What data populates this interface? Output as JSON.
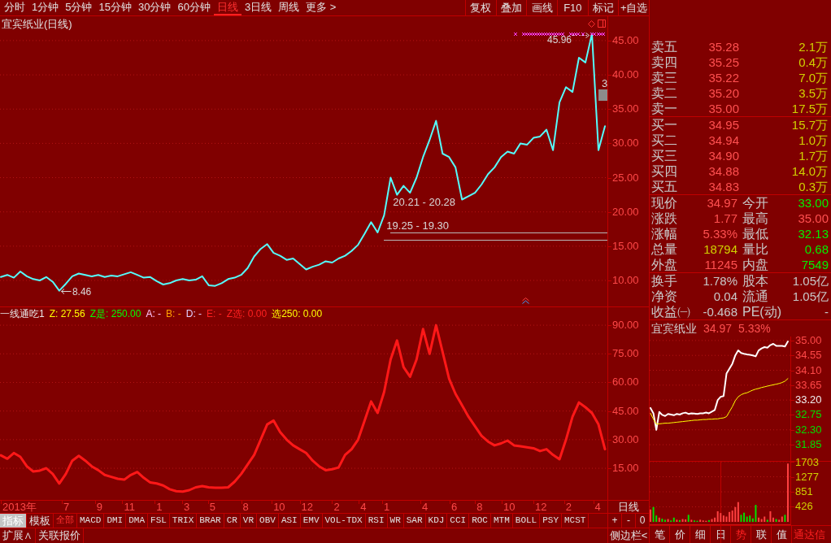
{
  "toolbar": {
    "periods": [
      {
        "label": "分时",
        "selected": false
      },
      {
        "label": "1分钟",
        "selected": false
      },
      {
        "label": "5分钟",
        "selected": false
      },
      {
        "label": "15分钟",
        "selected": false
      },
      {
        "label": "30分钟",
        "selected": false
      },
      {
        "label": "60分钟",
        "selected": false
      },
      {
        "label": "日线",
        "selected": true
      },
      {
        "label": "3日线",
        "selected": false
      },
      {
        "label": "周线",
        "selected": false
      },
      {
        "label": "更多 >",
        "selected": false
      }
    ],
    "buttons": [
      "复权",
      "叠加",
      "画线",
      "F10",
      "标记",
      "+自选"
    ]
  },
  "price_pane": {
    "title": "宜宾纸业(日线)",
    "chart_data": {
      "type": "line",
      "grid": true,
      "ylim": [
        6.2,
        48.55
      ],
      "yticks": [
        {
          "value": 10,
          "label": "10.00"
        },
        {
          "value": 15,
          "label": "15.00"
        },
        {
          "value": 20,
          "label": "20.00"
        },
        {
          "value": 25,
          "label": "25.00"
        },
        {
          "value": 30,
          "label": "30.00"
        },
        {
          "value": 35,
          "label": "35.00"
        },
        {
          "value": 40,
          "label": "40.00"
        },
        {
          "value": 45,
          "label": "45.00"
        }
      ],
      "values": [
        10.5,
        10.8,
        10.4,
        11.3,
        10.6,
        10.2,
        10.0,
        10.5,
        9.8,
        8.5,
        9.5,
        10.6,
        11.0,
        10.8,
        10.6,
        10.8,
        10.5,
        10.7,
        10.6,
        10.9,
        11.2,
        10.8,
        10.4,
        10.5,
        9.9,
        9.4,
        9.6,
        10.0,
        10.2,
        10.0,
        10.1,
        10.6,
        9.3,
        9.2,
        9.6,
        10.2,
        10.4,
        10.8,
        11.8,
        13.5,
        14.6,
        15.3,
        14.0,
        13.6,
        13.0,
        13.2,
        12.4,
        11.6,
        12.0,
        12.3,
        12.8,
        12.6,
        13.2,
        13.6,
        14.3,
        15.2,
        16.8,
        18.5,
        17.0,
        19.5,
        25.0,
        22.5,
        23.8,
        22.8,
        25.0,
        28.0,
        30.5,
        33.3,
        28.5,
        28.0,
        26.5,
        21.8,
        22.3,
        22.8,
        24.0,
        25.5,
        26.5,
        28.0,
        28.8,
        28.5,
        30.0,
        29.8,
        30.8,
        31.0,
        32.0,
        29.0,
        36.0,
        38.2,
        37.5,
        42.5,
        41.8,
        46.0,
        29.0,
        32.5
      ],
      "annotations": [
        "8.46",
        "45.96",
        "3",
        "20.21 - 20.28",
        "19.25 - 19.30"
      ]
    }
  },
  "indicator_pane": {
    "legend": [
      {
        "label": "一线通吃1",
        "color": "#e8e8e8"
      },
      {
        "label": "Z: 27.56",
        "color": "#ffff00"
      },
      {
        "label": "Z是: 250.00",
        "color": "#00ff00"
      },
      {
        "label": "A: -",
        "color": "#ffc8ff"
      },
      {
        "label": "B: -",
        "color": "#ffa000"
      },
      {
        "label": "D: -",
        "color": "#e0d0ff"
      },
      {
        "label": "E: -",
        "color": "#ff2020"
      },
      {
        "label": "Z选: 0.00",
        "color": "#ff2020"
      },
      {
        "label": "选250: 0.00",
        "color": "#ffff00"
      }
    ],
    "chart_data": {
      "type": "line",
      "grid": true,
      "ylim": [
        -1.6,
        99.4
      ],
      "yticks": [
        {
          "value": 15,
          "label": "15.00"
        },
        {
          "value": 30,
          "label": "30.00"
        },
        {
          "value": 45,
          "label": "45.00"
        },
        {
          "value": 60,
          "label": "60.00"
        },
        {
          "value": 75,
          "label": "75.00"
        },
        {
          "value": 90,
          "label": "90.00"
        }
      ],
      "values": [
        21.8,
        20,
        23,
        21,
        16,
        13.3,
        13.8,
        15,
        12,
        7,
        12,
        19,
        21.5,
        19,
        16,
        14,
        11.5,
        10.5,
        9.5,
        9,
        11.5,
        13,
        10,
        7.5,
        7,
        6,
        4,
        3,
        2.8,
        3.5,
        5,
        5.6,
        5,
        4.8,
        4.8,
        5,
        8,
        12,
        17,
        22,
        30,
        38,
        40,
        34,
        30,
        27,
        25,
        23,
        19,
        16,
        14,
        14.5,
        15.4,
        22,
        25,
        30,
        40,
        50,
        44,
        55,
        72,
        82,
        68,
        63,
        72,
        88,
        75,
        90,
        76,
        62,
        54,
        48,
        42,
        37,
        32,
        29,
        27,
        28,
        29.5,
        27,
        26.5,
        26,
        25.5,
        24,
        25,
        22,
        19.7,
        30,
        42,
        49.5,
        47,
        44,
        38,
        25
      ]
    }
  },
  "date_axis": {
    "ticks": [
      "2013年",
      "7",
      "9",
      "11",
      "1",
      "3",
      "5",
      "8",
      "10",
      "12",
      "2",
      "4",
      "1",
      "4",
      "6",
      "8",
      "10",
      "12",
      "2",
      "4"
    ],
    "period": "日线"
  },
  "indicator_bar": {
    "modes": [
      {
        "label": "指标",
        "selected": true
      },
      {
        "label": "模板",
        "selected": false
      }
    ],
    "indicators": [
      {
        "label": "全部",
        "selected": true
      },
      {
        "label": "MACD",
        "selected": false
      },
      {
        "label": "DMI",
        "selected": false
      },
      {
        "label": "DMA",
        "selected": false
      },
      {
        "label": "FSL",
        "selected": false
      },
      {
        "label": "TRIX",
        "selected": false
      },
      {
        "label": "BRAR",
        "selected": false
      },
      {
        "label": "CR",
        "selected": false
      },
      {
        "label": "VR",
        "selected": false
      },
      {
        "label": "OBV",
        "selected": false
      },
      {
        "label": "ASI",
        "selected": false
      },
      {
        "label": "EMV",
        "selected": false
      },
      {
        "label": "VOL-TDX",
        "selected": false
      },
      {
        "label": "RSI",
        "selected": false
      },
      {
        "label": "WR",
        "selected": false
      },
      {
        "label": "SAR",
        "selected": false
      },
      {
        "label": "KDJ",
        "selected": false
      },
      {
        "label": "CCI",
        "selected": false
      },
      {
        "label": "ROC",
        "selected": false
      },
      {
        "label": "MTM",
        "selected": false
      },
      {
        "label": "BOLL",
        "selected": false
      },
      {
        "label": "PSY",
        "selected": false
      },
      {
        "label": "MCST",
        "selected": false
      }
    ],
    "zoom_buttons": [
      "+",
      "-",
      "0"
    ]
  },
  "bottom_bar": {
    "buttons": [
      "扩展∧",
      "关联报价"
    ],
    "sidebar_toggle": "侧边栏<"
  },
  "quote_panel": {
    "asks": [
      {
        "label": "卖五",
        "price": "35.28",
        "volume": "2.1万"
      },
      {
        "label": "卖四",
        "price": "35.25",
        "volume": "0.4万"
      },
      {
        "label": "卖三",
        "price": "35.22",
        "volume": "7.0万"
      },
      {
        "label": "卖二",
        "price": "35.20",
        "volume": "3.5万"
      },
      {
        "label": "卖一",
        "price": "35.00",
        "volume": "17.5万"
      }
    ],
    "bids": [
      {
        "label": "买一",
        "price": "34.95",
        "volume": "15.7万"
      },
      {
        "label": "买二",
        "price": "34.94",
        "volume": "1.0万"
      },
      {
        "label": "买三",
        "price": "34.90",
        "volume": "1.7万"
      },
      {
        "label": "买四",
        "price": "34.88",
        "volume": "14.0万"
      },
      {
        "label": "买五",
        "price": "34.83",
        "volume": "0.3万"
      }
    ],
    "stats": [
      {
        "label": "现价",
        "value": "34.97",
        "color": "#ff5050"
      },
      {
        "label": "今开",
        "value": "33.00",
        "color": "#00f000"
      },
      {
        "label": "涨跌",
        "value": "1.77",
        "color": "#ff5050"
      },
      {
        "label": "最高",
        "value": "35.00",
        "color": "#ff5050"
      },
      {
        "label": "涨幅",
        "value": "5.33%",
        "color": "#ff5050"
      },
      {
        "label": "最低",
        "value": "32.13",
        "color": "#00f000"
      },
      {
        "label": "总量",
        "value": "18794",
        "color": "#d0d000"
      },
      {
        "label": "量比",
        "value": "0.68",
        "color": "#00f000"
      },
      {
        "label": "外盘",
        "value": "11245",
        "color": "#ff5050"
      },
      {
        "label": "内盘",
        "value": "7549",
        "color": "#00f000"
      }
    ],
    "info": [
      {
        "label": "换手",
        "value": "1.78%"
      },
      {
        "label": "股本",
        "value": "1.05亿"
      },
      {
        "label": "净资",
        "value": "0.04"
      },
      {
        "label": "流通",
        "value": "1.05亿"
      },
      {
        "label": "收益㈠",
        "value": "-0.468"
      },
      {
        "label": "PE(动)",
        "value": "-"
      }
    ]
  },
  "intraday": {
    "name": "宜宾纸业",
    "price": "34.97",
    "change": "5.33%",
    "chart_data": {
      "type": "line",
      "grid": true,
      "ylim": [
        31.36,
        35.12
      ],
      "yticks": [
        {
          "value": 35,
          "label": "35.00"
        },
        {
          "value": 34.55,
          "label": "34.55"
        },
        {
          "value": 34.1,
          "label": "34.10"
        },
        {
          "value": 33.65,
          "label": "33.65"
        },
        {
          "value": 33.2,
          "label": "33.20"
        },
        {
          "value": 32.75,
          "label": "32.75"
        },
        {
          "value": 32.3,
          "label": "32.30"
        },
        {
          "value": 31.85,
          "label": "31.85"
        }
      ],
      "series": [
        {
          "color": "#ffffff",
          "values": [
            32.96,
            32.8,
            32.3,
            32.84,
            32.75,
            32.72,
            32.78,
            32.76,
            32.74,
            32.78,
            32.76,
            32.8,
            32.82,
            32.78,
            32.8,
            32.79,
            32.78,
            32.8,
            32.8,
            32.82,
            32.8,
            32.85,
            32.9,
            33.2,
            33.3,
            33.32,
            34.0,
            34.15,
            34.3,
            34.55,
            34.7,
            34.62,
            34.6,
            34.58,
            34.57,
            34.55,
            34.52,
            34.7,
            34.76,
            34.8,
            34.78,
            34.86,
            34.9,
            34.84,
            34.84,
            34.84,
            34.82,
            34.97
          ]
        },
        {
          "color": "#ffff00",
          "values": [
            32.8,
            32.62,
            32.47,
            32.48,
            32.49,
            32.5,
            32.5,
            32.51,
            32.52,
            32.53,
            32.54,
            32.55,
            32.56,
            32.57,
            32.58,
            32.59,
            32.59,
            32.6,
            32.61,
            32.61,
            32.62,
            32.62,
            32.63,
            32.63,
            32.65,
            32.66,
            32.7,
            32.85,
            33.0,
            33.18,
            33.3,
            33.36,
            33.4,
            33.42,
            33.46,
            33.5,
            33.53,
            33.55,
            33.58,
            33.6,
            33.62,
            33.64,
            33.66,
            33.68,
            33.7,
            33.73,
            33.77,
            33.85
          ]
        }
      ]
    }
  },
  "intraday_volume": {
    "chart_data": {
      "type": "bar",
      "grid": true,
      "ylim": [
        0,
        1703
      ],
      "yticks": [
        {
          "value": 1703,
          "label": "1703"
        },
        {
          "value": 1277,
          "label": "1277"
        },
        {
          "value": 851,
          "label": "851"
        },
        {
          "value": 426,
          "label": "426"
        }
      ],
      "values": [
        350,
        420,
        180,
        120,
        90,
        60,
        80,
        40,
        120,
        60,
        50,
        80,
        70,
        200,
        60,
        40,
        30,
        60,
        40,
        30,
        50,
        80,
        120,
        300,
        250,
        180,
        150,
        280,
        320,
        420,
        560,
        200,
        260,
        150,
        180,
        100,
        480,
        120,
        80,
        150,
        60,
        300,
        120,
        80,
        60,
        150,
        200,
        1650
      ]
    }
  },
  "side_tabs": [
    {
      "label": "笔",
      "selected": false
    },
    {
      "label": "价",
      "selected": false
    },
    {
      "label": "细",
      "selected": false
    },
    {
      "label": "日",
      "selected": false
    },
    {
      "label": "势",
      "selected": true
    },
    {
      "label": "联",
      "selected": false
    },
    {
      "label": "值",
      "selected": false
    }
  ],
  "brand_text": "通达信"
}
